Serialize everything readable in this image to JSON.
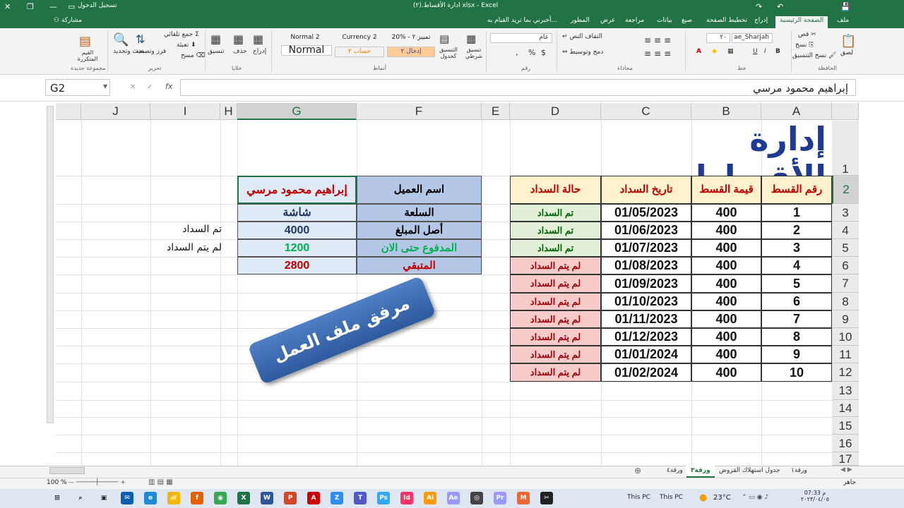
{
  "window": {
    "title": "ادارة الأقساط.(٢) xlsx - Excel",
    "login": "تسجيل الدخول",
    "share": "مشاركة",
    "tell_me": "أخبرني بما تريد القيام به...",
    "icons": [
      "save-icon",
      "undo-icon",
      "redo-icon",
      "close-icon",
      "restore-icon",
      "minimize-icon",
      "ribbon-display-icon"
    ]
  },
  "ribbon_tabs": [
    "ملف",
    "الصفحة الرئيسية",
    "إدراج",
    "تخطيط الصفحة",
    "صيغ",
    "بيانات",
    "مراجعة",
    "عرض",
    "المطور"
  ],
  "ribbon": {
    "clipboard": {
      "cut": "قص",
      "copy": "نسخ",
      "format_painter": "نسخ التنسيق",
      "paste": "لصق",
      "group": "الحافظة"
    },
    "font": {
      "name": "ae_Sharjah",
      "size": "٢٠",
      "group": "خط",
      "bold": "B",
      "italic": "I",
      "underline": "U"
    },
    "alignment": {
      "wrap": "التفاف النص",
      "merge": "دمج وتوسيط",
      "group": "محاذاة"
    },
    "number": {
      "format": "عام",
      "group": "رقم",
      "percent": "%",
      "comma": ",",
      "currency": "$"
    },
    "styles": {
      "conditional": "تنسيق شرطي",
      "format_table": "التنسيق كجدول",
      "cell_styles": [
        "Normal 2",
        "Currency 2",
        "20% - تمييز ٢",
        "Normal",
        "حساب ٢",
        "إدخال ٢"
      ],
      "group": "أنماط"
    },
    "cells": {
      "insert": "إدراج",
      "delete": "حذف",
      "format": "تنسيق",
      "group": "خلايا"
    },
    "editing": {
      "autosum": "جمع تلقائي",
      "fill": "تعبئة",
      "clear": "مسح",
      "sort": "فرز وتصفية",
      "find": "بحث وتحديد",
      "group": "تحرير"
    },
    "addins": {
      "label": "القيم المتكررة",
      "group": "مجموعة جديدة"
    }
  },
  "formula_bar": {
    "name_box": "G2",
    "fx": "fx",
    "value": "إبراهيم محمود مرسي"
  },
  "columns": [
    {
      "letter": "A",
      "sel": false
    },
    {
      "letter": "B",
      "sel": false
    },
    {
      "letter": "C",
      "sel": false
    },
    {
      "letter": "D",
      "sel": false
    },
    {
      "letter": "E",
      "sel": false
    },
    {
      "letter": "F",
      "sel": false
    },
    {
      "letter": "G",
      "sel": true
    },
    {
      "letter": "H",
      "sel": false
    },
    {
      "letter": "I",
      "sel": false
    },
    {
      "letter": "J",
      "sel": false
    }
  ],
  "rows": [
    "1",
    "2",
    "3",
    "4",
    "5",
    "6",
    "7",
    "8",
    "9",
    "10",
    "11",
    "12",
    "13",
    "14",
    "15",
    "16",
    "17"
  ],
  "sheet": {
    "title": "إدارة الأقساط",
    "table_headers": [
      "رقم القسط",
      "قيمة القسط",
      "تاريخ السداد",
      "حالة السداد"
    ],
    "installments": [
      {
        "no": "1",
        "amount": "400",
        "date": "01/05/2023",
        "status": "تم السداد",
        "paid": true
      },
      {
        "no": "2",
        "amount": "400",
        "date": "01/06/2023",
        "status": "تم السداد",
        "paid": true
      },
      {
        "no": "3",
        "amount": "400",
        "date": "01/07/2023",
        "status": "تم السداد",
        "paid": true
      },
      {
        "no": "4",
        "amount": "400",
        "date": "01/08/2023",
        "status": "لم يتم السداد",
        "paid": false
      },
      {
        "no": "5",
        "amount": "400",
        "date": "01/09/2023",
        "status": "لم يتم السداد",
        "paid": false
      },
      {
        "no": "6",
        "amount": "400",
        "date": "01/10/2023",
        "status": "لم يتم السداد",
        "paid": false
      },
      {
        "no": "7",
        "amount": "400",
        "date": "01/11/2023",
        "status": "لم يتم السداد",
        "paid": false
      },
      {
        "no": "8",
        "amount": "400",
        "date": "01/12/2023",
        "status": "لم يتم السداد",
        "paid": false
      },
      {
        "no": "9",
        "amount": "400",
        "date": "01/01/2024",
        "status": "لم يتم السداد",
        "paid": false
      },
      {
        "no": "10",
        "amount": "400",
        "date": "01/02/2024",
        "status": "لم يتم السداد",
        "paid": false
      }
    ],
    "summary": [
      {
        "label": "اسم العميل",
        "value": "إبراهيم محمود مرسي",
        "color": "#c00000"
      },
      {
        "label": "السلعة",
        "value": "شاشة",
        "color": "#1f3864"
      },
      {
        "label": "أصل المبلغ",
        "value": "4000",
        "color": "#1f3864"
      },
      {
        "label": "المدفوع حتى الان",
        "value": "1200",
        "color": "#00b050"
      },
      {
        "label": "المتبقي",
        "value": "2800",
        "color": "#c00000"
      }
    ],
    "summary_label_colors": [
      "#000000",
      "#000000",
      "#000000",
      "#00b050",
      "#c00000"
    ],
    "legend": [
      "تم السداد",
      "لم يتم السداد"
    ],
    "banner": "مرفق ملف العمل"
  },
  "sheet_tabs": [
    {
      "label": "ورقة١",
      "active": false
    },
    {
      "label": "جدول استهلاك القروض",
      "active": false
    },
    {
      "label": "ورقة٣",
      "active": true
    },
    {
      "label": "ورقة٤",
      "active": false
    }
  ],
  "status": {
    "ready": "جاهز",
    "zoom": "100 %"
  },
  "taskbar": {
    "this_pc_1": "This PC",
    "this_pc_2": "This PC",
    "weather": "23°C",
    "time": "07:33 م",
    "date": "٢٠٢٣/٠٤/٠٥",
    "apps": [
      "windows",
      "search",
      "task-view",
      "mail",
      "edge",
      "explorer",
      "firefox",
      "chrome",
      "excel",
      "word",
      "powerpoint",
      "pdf",
      "zoom",
      "teams",
      "photoshop",
      "indesign",
      "illustrator",
      "after-effects",
      "app",
      "premiere",
      "media",
      "capcut"
    ]
  }
}
